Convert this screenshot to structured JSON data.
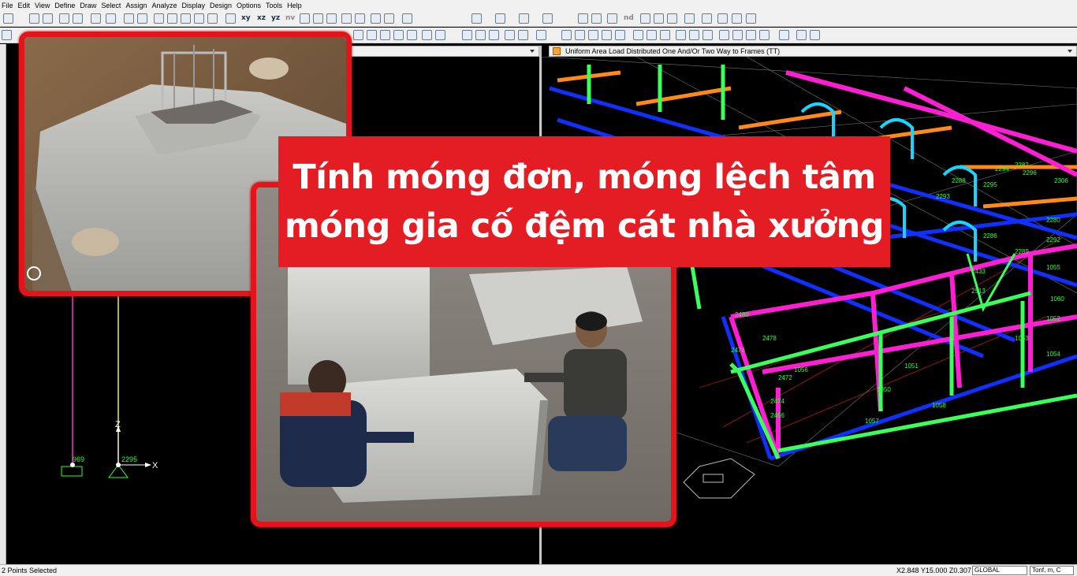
{
  "menu": [
    "File",
    "Edit",
    "View",
    "Define",
    "Draw",
    "Select",
    "Assign",
    "Analyze",
    "Display",
    "Design",
    "Options",
    "Tools",
    "Help"
  ],
  "toolbar": {
    "view_labels": [
      "xy",
      "xz",
      "yz",
      "nv"
    ],
    "nd_label": "nd"
  },
  "windows": {
    "right_title": "Uniform Area Load Distributed One And/Or Two Way to Frames (TT)"
  },
  "left_view": {
    "axis_x": "X",
    "axis_z": "Z",
    "joint_labels": [
      "969",
      "2295"
    ]
  },
  "right_view": {
    "frame_labels": [
      "2294",
      "2296",
      "2288",
      "2295",
      "2433",
      "2513",
      "2480",
      "2478",
      "2476",
      "2472",
      "1056",
      "1051",
      "1050",
      "2474",
      "2466",
      "1057",
      "1058",
      "1052",
      "1060",
      "1053",
      "1054",
      "1055",
      "2280",
      "2292",
      "2289",
      "2286",
      "2282",
      "2306",
      "2293"
    ]
  },
  "overlay": {
    "title_line1": "Tính móng đơn, móng lệch tâm",
    "title_line2": "móng gia cố đệm cát nhà xưởng"
  },
  "status": {
    "selection": "2 Points Selected",
    "coords": "X2.848  Y15.000  Z0.307",
    "coord_system": "GLOBAL",
    "units": "Tonf, m, C"
  },
  "colors": {
    "banner": "#e41d24",
    "photo_border": "#e3141c",
    "frame_magenta": "#ff1fd2",
    "frame_green": "#3bff5a",
    "frame_blue": "#1030ff",
    "frame_orange": "#ff8a1a",
    "frame_cyan": "#19d4ff"
  }
}
